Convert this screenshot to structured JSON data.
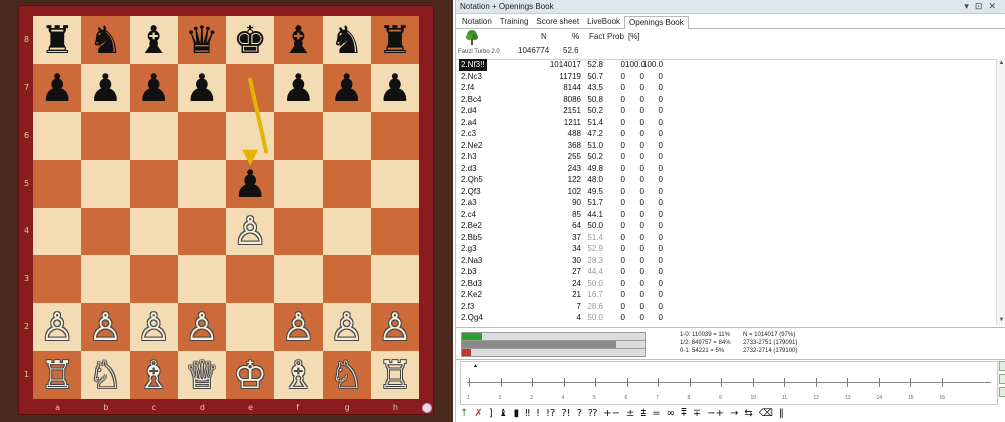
{
  "board": {
    "ranks": [
      "8",
      "7",
      "6",
      "5",
      "4",
      "3",
      "2",
      "1"
    ],
    "files": [
      "a",
      "b",
      "c",
      "d",
      "e",
      "f",
      "g",
      "h"
    ],
    "pieces": [
      "♜♞♝♛♚♝♞♜",
      "♟♟♟♟.♟♟♟",
      "........",
      "....♟...",
      "....♙...",
      "........",
      "♙♙♙♙.♙♙♙",
      "♖♘♗♕♔♗♘♖"
    ],
    "last_move": {
      "from": "e7",
      "to": "e5"
    },
    "arrow_color": "#e6b400",
    "light_square_color": "#f3dcb4",
    "dark_square_color": "#cd6a3a",
    "frame_color": "#8a1c1f"
  },
  "window": {
    "title": "Notation + Openings Book",
    "controls": [
      "▾",
      "⊡",
      "✕"
    ]
  },
  "tabs": [
    {
      "label": "Notation",
      "active": false
    },
    {
      "label": "Training",
      "active": false
    },
    {
      "label": "Score sheet",
      "active": false
    },
    {
      "label": "LiveBook",
      "active": false
    },
    {
      "label": "Openings Book",
      "active": true
    }
  ],
  "book": {
    "engine_label": "Fauzi Turbo 2.0",
    "headers": {
      "n": "N",
      "pct": "%",
      "fact": "Fact",
      "prob": "Prob",
      "pc": "[%]"
    },
    "total_n": "1046774",
    "total_pct": "52.6",
    "rows": [
      {
        "move": "2.Nf3!!",
        "n": "1014017",
        "pct": "52.8",
        "fact": "0",
        "prob": "100.0",
        "pc": "100.0",
        "selected": true,
        "dim": false
      },
      {
        "move": "2.Nc3",
        "n": "11719",
        "pct": "50.7",
        "fact": "0",
        "prob": "0",
        "pc": "0",
        "selected": false,
        "dim": false
      },
      {
        "move": "2.f4",
        "n": "8144",
        "pct": "43.5",
        "fact": "0",
        "prob": "0",
        "pc": "0",
        "selected": false,
        "dim": false
      },
      {
        "move": "2.Bc4",
        "n": "8086",
        "pct": "50.8",
        "fact": "0",
        "prob": "0",
        "pc": "0",
        "selected": false,
        "dim": false
      },
      {
        "move": "2.d4",
        "n": "2151",
        "pct": "50.2",
        "fact": "0",
        "prob": "0",
        "pc": "0",
        "selected": false,
        "dim": false
      },
      {
        "move": "2.a4",
        "n": "1211",
        "pct": "51.4",
        "fact": "0",
        "prob": "0",
        "pc": "0",
        "selected": false,
        "dim": false
      },
      {
        "move": "2.c3",
        "n": "488",
        "pct": "47.2",
        "fact": "0",
        "prob": "0",
        "pc": "0",
        "selected": false,
        "dim": false
      },
      {
        "move": "2.Ne2",
        "n": "368",
        "pct": "51.0",
        "fact": "0",
        "prob": "0",
        "pc": "0",
        "selected": false,
        "dim": false
      },
      {
        "move": "2.h3",
        "n": "255",
        "pct": "50.2",
        "fact": "0",
        "prob": "0",
        "pc": "0",
        "selected": false,
        "dim": false
      },
      {
        "move": "2.d3",
        "n": "243",
        "pct": "49.8",
        "fact": "0",
        "prob": "0",
        "pc": "0",
        "selected": false,
        "dim": false
      },
      {
        "move": "2.Qh5",
        "n": "122",
        "pct": "48.0",
        "fact": "0",
        "prob": "0",
        "pc": "0",
        "selected": false,
        "dim": false
      },
      {
        "move": "2.Qf3",
        "n": "102",
        "pct": "49.5",
        "fact": "0",
        "prob": "0",
        "pc": "0",
        "selected": false,
        "dim": false
      },
      {
        "move": "2.a3",
        "n": "90",
        "pct": "51.7",
        "fact": "0",
        "prob": "0",
        "pc": "0",
        "selected": false,
        "dim": false
      },
      {
        "move": "2.c4",
        "n": "85",
        "pct": "44.1",
        "fact": "0",
        "prob": "0",
        "pc": "0",
        "selected": false,
        "dim": false
      },
      {
        "move": "2.Be2",
        "n": "64",
        "pct": "50.0",
        "fact": "0",
        "prob": "0",
        "pc": "0",
        "selected": false,
        "dim": false
      },
      {
        "move": "2.Bb5",
        "n": "37",
        "pct": "51.4",
        "fact": "0",
        "prob": "0",
        "pc": "0",
        "selected": false,
        "dim": true
      },
      {
        "move": "2.g3",
        "n": "34",
        "pct": "52.9",
        "fact": "0",
        "prob": "0",
        "pc": "0",
        "selected": false,
        "dim": true
      },
      {
        "move": "2.Na3",
        "n": "30",
        "pct": "28.3",
        "fact": "0",
        "prob": "0",
        "pc": "0",
        "selected": false,
        "dim": true
      },
      {
        "move": "2.b3",
        "n": "27",
        "pct": "44.4",
        "fact": "0",
        "prob": "0",
        "pc": "0",
        "selected": false,
        "dim": true
      },
      {
        "move": "2.Bd3",
        "n": "24",
        "pct": "50.0",
        "fact": "0",
        "prob": "0",
        "pc": "0",
        "selected": false,
        "dim": true
      },
      {
        "move": "2.Ke2",
        "n": "21",
        "pct": "16.7",
        "fact": "0",
        "prob": "0",
        "pc": "0",
        "selected": false,
        "dim": true
      },
      {
        "move": "2.f3",
        "n": "7",
        "pct": "28.6",
        "fact": "0",
        "prob": "0",
        "pc": "0",
        "selected": false,
        "dim": true
      },
      {
        "move": "2.Qg4",
        "n": "4",
        "pct": "50.0",
        "fact": "0",
        "prob": "0",
        "pc": "0",
        "selected": false,
        "dim": true
      }
    ]
  },
  "stats": {
    "white_line": "1-0: 110039 = 11%",
    "draw_line": "1/2: 849757 = 84%",
    "black_line": "0-1: 54221 = 5%",
    "n_line": "N = 1014017 (97%)",
    "elo_line1": "2733-2751 (179091)",
    "elo_line2": "2732-2714 (179100)",
    "white_fraction": 0.11,
    "draw_fraction": 0.84,
    "black_fraction": 0.05,
    "colors": {
      "white": "#2ca02c",
      "draw": "#8a8a8a",
      "black": "#c0392b"
    }
  },
  "timeline": {
    "labels": [
      "1",
      "2",
      "3",
      "4",
      "5",
      "6",
      "7",
      "8",
      "9",
      "10",
      "11",
      "12",
      "13",
      "14",
      "15",
      "16"
    ]
  },
  "annotation_symbols": [
    "↑",
    "✗",
    "]",
    "♝",
    "▮",
    "‼",
    "!",
    "!?",
    "?!",
    "?",
    "⁇",
    "+−",
    "±",
    "⩲",
    "=",
    "∞",
    "⩱",
    "∓",
    "−+",
    "→",
    "⇆",
    "⌫",
    "‖"
  ]
}
